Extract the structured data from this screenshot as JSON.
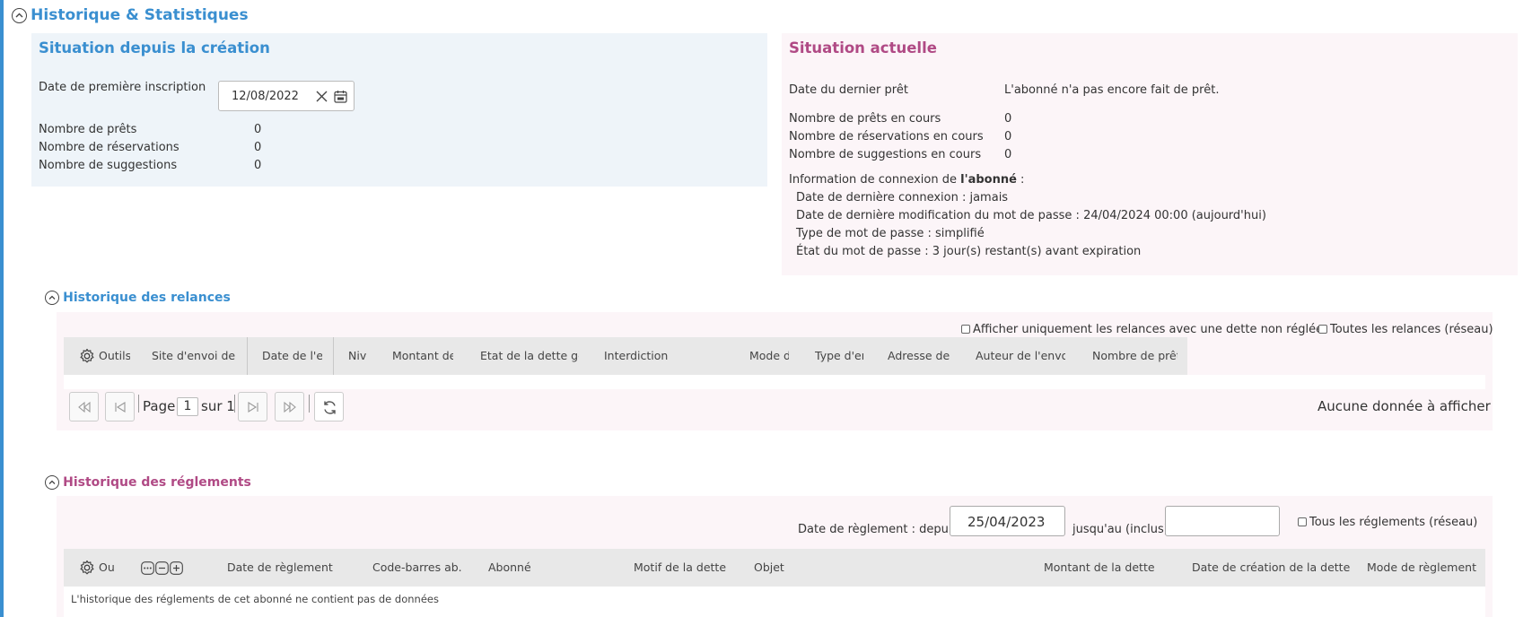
{
  "header": {
    "title": "Historique & Statistiques"
  },
  "since_creation": {
    "title": "Situation depuis la création",
    "first_registration_label": "Date de première inscription",
    "first_registration_value": "12/08/2022",
    "rows": [
      {
        "label": "Nombre de prêts",
        "value": "0"
      },
      {
        "label": "Nombre de réservations",
        "value": "0"
      },
      {
        "label": "Nombre de suggestions",
        "value": "0"
      }
    ]
  },
  "current": {
    "title": "Situation actuelle",
    "last_loan_label": "Date du dernier prêt",
    "last_loan_value": "L'abonné n'a pas encore fait de prêt.",
    "rows": [
      {
        "label": "Nombre de prêts en cours",
        "value": "0"
      },
      {
        "label": "Nombre de réservations en cours",
        "value": "0"
      },
      {
        "label": "Nombre de suggestions en cours",
        "value": "0"
      }
    ],
    "connection_prefix": "Information de connexion de ",
    "connection_bold": "l'abonné",
    "connection_suffix": " :",
    "connection_lines": [
      "Date de dernière connexion : jamais",
      "Date de dernière modification du mot de passe : 24/04/2024 00:00 (aujourd'hui)",
      "Type de mot de passe : simplifié",
      "État du mot de passe : 3 jour(s) restant(s) avant expiration"
    ]
  },
  "relances": {
    "title": "Historique des relances",
    "filter_unpaid": "Afficher uniquement les relances avec une dette non réglée",
    "filter_network": "Toutes les relances (réseau)",
    "tools_label": "Outils",
    "columns": [
      "Site d'envoi de l",
      "Date de l'er",
      "Nive",
      "Montant de",
      "Etat de la dette gé",
      "Interdiction",
      "Mode d'",
      "Type d'er",
      "Adresse des",
      "Auteur de l'envoi",
      "Nombre de prêt"
    ],
    "pager": {
      "page_label": "Page",
      "page_value": "1",
      "of_label": "sur 1"
    },
    "empty_text": "Aucune donnée à afficher"
  },
  "reglements": {
    "title": "Historique des réglements",
    "date_from_label": "Date de règlement : depuis",
    "date_from_value": "25/04/2023",
    "date_to_label": "jusqu'au (inclus)",
    "date_to_value": "",
    "filter_network": "Tous les réglements (réseau)",
    "tools_label": "Ou",
    "columns": [
      "Date de règlement",
      "Code-barres ab.",
      "Abonné",
      "Motif de la dette",
      "Objet",
      "Montant de la dette",
      "Date de création de la dette",
      "Mode de règlement"
    ],
    "empty_text": "L'historique des réglements de cet abonné ne contient pas de données"
  },
  "colors": {
    "accent_blue": "#3a8fd0",
    "accent_pink": "#b04a85",
    "panel_blue": "#eef4f9",
    "panel_pink": "#fcf5f8"
  }
}
